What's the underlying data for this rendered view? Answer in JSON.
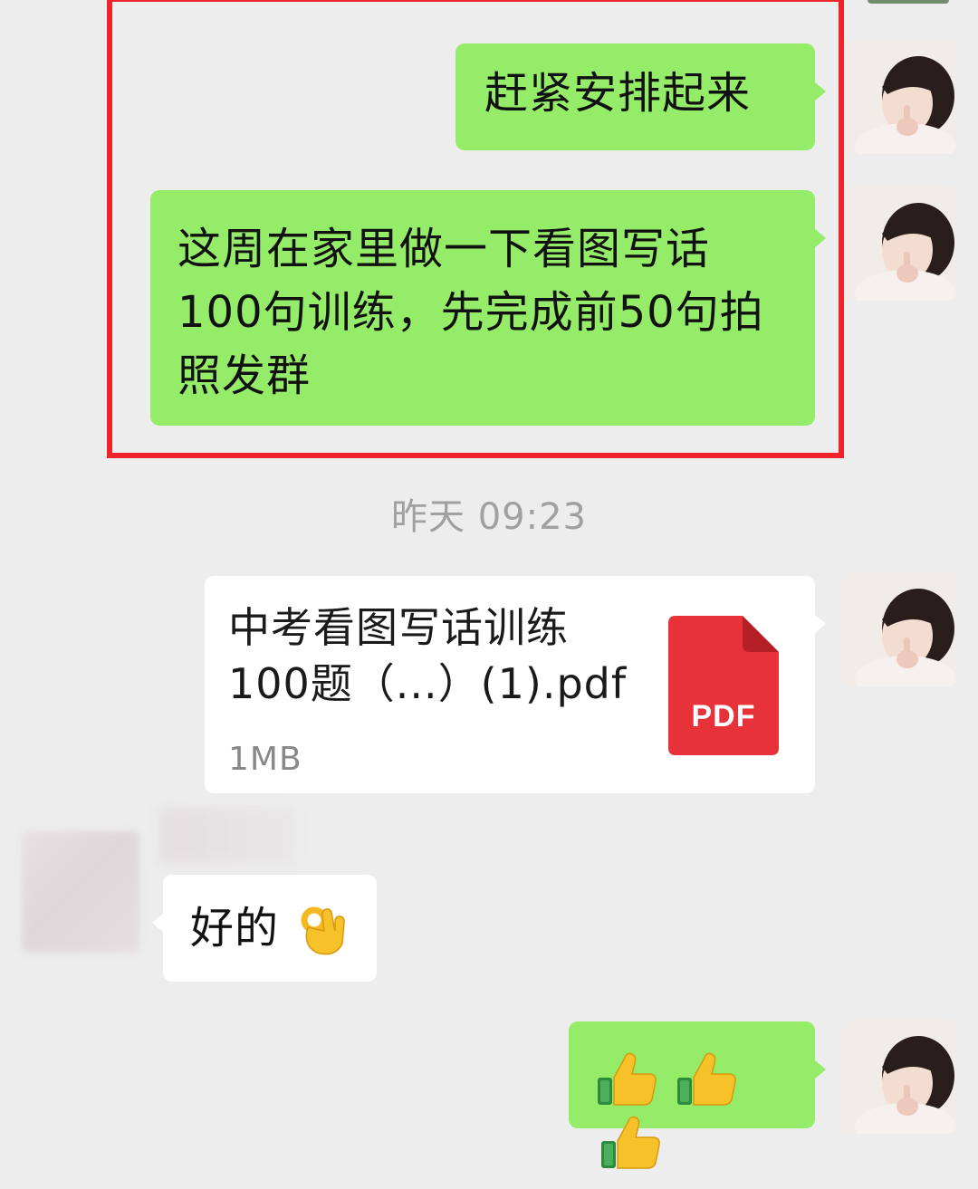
{
  "messages": {
    "m1": {
      "text": "赶紧安排起来"
    },
    "m2": {
      "text": "这周在家里做一下看图写话100句训练，先完成前50句拍照发群"
    },
    "timestamp": "昨天 09:23",
    "file": {
      "name": "中考看图写话训练100题（...）(1).pdf",
      "size": "1MB",
      "icon_label": "PDF"
    },
    "reply": {
      "text": "好的",
      "emoji": "👌"
    },
    "thumbs": {
      "text": "👍👍👍"
    }
  },
  "colors": {
    "background": "#ededed",
    "sent_bubble": "#95ec69",
    "received_bubble": "#ffffff",
    "highlight": "#f0232b",
    "pdf_red": "#e8323a",
    "timestamp": "#a0a0a0"
  },
  "icons": {
    "pdf": "pdf-file-icon",
    "ok_hand": "ok-hand-emoji",
    "thumbs_up": "thumbs-up-emoji"
  }
}
